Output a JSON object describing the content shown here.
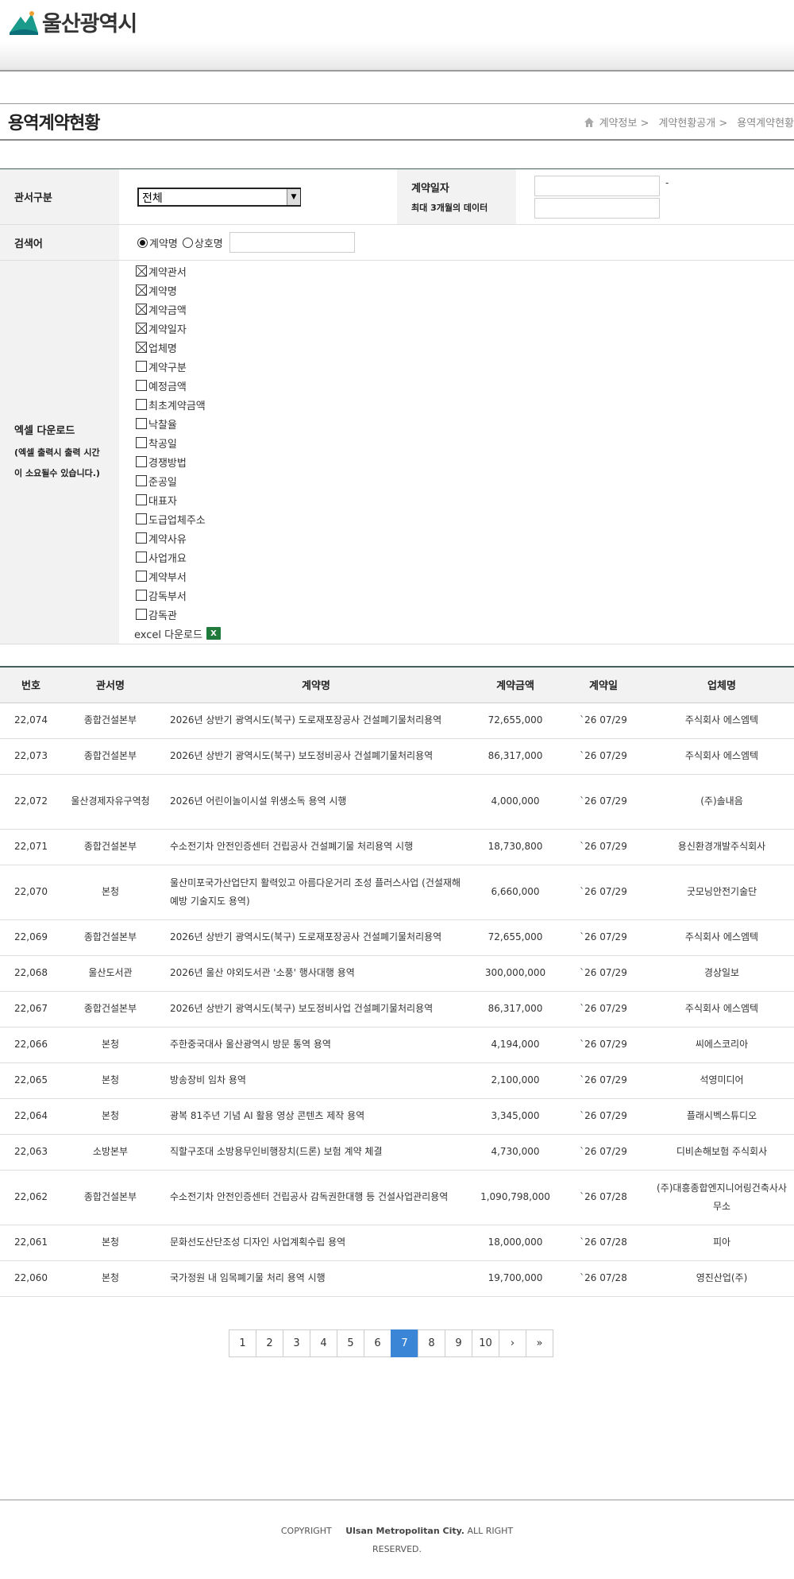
{
  "header": {
    "logo_text": "울산광역시"
  },
  "page": {
    "title": "용역계약현황",
    "breadcrumb": [
      "계약정보 >",
      "계약현황공개 >",
      "용역계약현황"
    ]
  },
  "search": {
    "dept_label": "관서구분",
    "dept_value": "전체",
    "date_label": "계약일자",
    "date_sub": "최대 3개월의 데이터",
    "date_dash": "-",
    "keyword_label": "검색어",
    "radio_contract": "계약명",
    "radio_company": "상호명",
    "excel_label": "엑셀 다운로드",
    "excel_sub": "(엑셀 출력시 출력 시간이 소요될수 있습니다.)",
    "excel_sub1": "(엑셀 출력시 출력 시간",
    "excel_sub2": "이 소요될수 있습니다.)",
    "checkboxes": [
      {
        "label": "계약관서",
        "checked": true
      },
      {
        "label": "계약명",
        "checked": true
      },
      {
        "label": "계약금액",
        "checked": true
      },
      {
        "label": "계약일자",
        "checked": true
      },
      {
        "label": "업체명",
        "checked": true
      },
      {
        "label": "계약구분",
        "checked": false
      },
      {
        "label": "예정금액",
        "checked": false
      },
      {
        "label": "최초계약금액",
        "checked": false
      },
      {
        "label": "낙찰율",
        "checked": false
      },
      {
        "label": "착공일",
        "checked": false
      },
      {
        "label": "경쟁방법",
        "checked": false
      },
      {
        "label": "준공일",
        "checked": false
      },
      {
        "label": "대표자",
        "checked": false
      },
      {
        "label": "도급업체주소",
        "checked": false
      },
      {
        "label": "계약사유",
        "checked": false
      },
      {
        "label": "사업개요",
        "checked": false
      },
      {
        "label": "계약부서",
        "checked": false
      },
      {
        "label": "감독부서",
        "checked": false
      },
      {
        "label": "감독관",
        "checked": false
      }
    ],
    "excel_download": "excel 다운로드"
  },
  "table": {
    "headers": [
      "번호",
      "관서명",
      "계약명",
      "계약금액",
      "계약일",
      "업체명"
    ],
    "rows": [
      {
        "no": "22,074",
        "dept": "종합건설본부",
        "name": "2026년 상반기 광역시도(북구) 도로재포장공사 건설폐기물처리용역",
        "amount": "72,655,000",
        "date": "`26 07/29",
        "company": "주식회사 에스엠텍"
      },
      {
        "no": "22,073",
        "dept": "종합건설본부",
        "name": "2026년 상반기 광역시도(북구) 보도정비공사 건설폐기물처리용역",
        "amount": "86,317,000",
        "date": "`26 07/29",
        "company": "주식회사 에스엠텍"
      },
      {
        "no": "22,072",
        "dept": "울산경제자유구역청",
        "name": "2026년 어린이놀이시설 위생소독 용역 시행",
        "amount": "4,000,000",
        "date": "`26 07/29",
        "company": "(주)솔내음"
      },
      {
        "no": "22,071",
        "dept": "종합건설본부",
        "name": "수소전기차 안전인증센터 건립공사 건설폐기물 처리용역 시행",
        "amount": "18,730,800",
        "date": "`26 07/29",
        "company": "용신환경개발주식회사"
      },
      {
        "no": "22,070",
        "dept": "본청",
        "name": "울산미포국가산업단지 활력있고 아름다운거리 조성 플러스사업 (건설재해예방 기술지도 용역)",
        "amount": "6,660,000",
        "date": "`26 07/29",
        "company": "굿모닝안전기술단"
      },
      {
        "no": "22,069",
        "dept": "종합건설본부",
        "name": "2026년 상반기 광역시도(북구) 도로재포장공사 건설폐기물처리용역",
        "amount": "72,655,000",
        "date": "`26 07/29",
        "company": "주식회사 에스엠텍"
      },
      {
        "no": "22,068",
        "dept": "울산도서관",
        "name": "2026년 울산 야외도서관 '소풍' 행사대행 용역",
        "amount": "300,000,000",
        "date": "`26 07/29",
        "company": "경상일보"
      },
      {
        "no": "22,067",
        "dept": "종합건설본부",
        "name": "2026년 상반기 광역시도(북구) 보도정비사업 건설폐기물처리용역",
        "amount": "86,317,000",
        "date": "`26 07/29",
        "company": "주식회사 에스엠텍"
      },
      {
        "no": "22,066",
        "dept": "본청",
        "name": "주한중국대사 울산광역시 방문 통역 용역",
        "amount": "4,194,000",
        "date": "`26 07/29",
        "company": "씨에스코리아"
      },
      {
        "no": "22,065",
        "dept": "본청",
        "name": "방송장비 임차 용역",
        "amount": "2,100,000",
        "date": "`26 07/29",
        "company": "석영미디어"
      },
      {
        "no": "22,064",
        "dept": "본청",
        "name": "광복 81주년 기념 AI 활용 영상 콘텐츠 제작 용역",
        "amount": "3,345,000",
        "date": "`26 07/29",
        "company": "플래시벡스튜디오"
      },
      {
        "no": "22,063",
        "dept": "소방본부",
        "name": "직할구조대 소방용무인비행장치(드론) 보험 계약 체결",
        "amount": "4,730,000",
        "date": "`26 07/29",
        "company": "디비손해보험 주식회사"
      },
      {
        "no": "22,062",
        "dept": "종합건설본부",
        "name": "수소전기차 안전인증센터 건립공사 감독권한대행 등 건설사업관리용역",
        "amount": "1,090,798,000",
        "date": "`26 07/28",
        "company": "(주)대흥종합엔지니어링건축사사무소"
      },
      {
        "no": "22,061",
        "dept": "본청",
        "name": "문화선도산단조성 디자인 사업계획수립 용역",
        "amount": "18,000,000",
        "date": "`26 07/28",
        "company": "피아"
      },
      {
        "no": "22,060",
        "dept": "본청",
        "name": "국가정원 내 임목폐기물 처리 용역 시행",
        "amount": "19,700,000",
        "date": "`26 07/28",
        "company": "영진산업(주)"
      }
    ]
  },
  "pager": {
    "pages": [
      "1",
      "2",
      "3",
      "4",
      "5",
      "6",
      "7",
      "8",
      "9",
      "10"
    ],
    "current": "7",
    "next": "›",
    "last": "»"
  },
  "footer": {
    "copyright": "COPYRIGHT",
    "owner": "Ulsan Metropolitan City.",
    "rights": "ALL RIGHT",
    "reserved": "RESERVED."
  },
  "colors": {
    "accent": "#3a85d6",
    "logo_green": "#1a9a8a",
    "table_line": "#44605a"
  }
}
